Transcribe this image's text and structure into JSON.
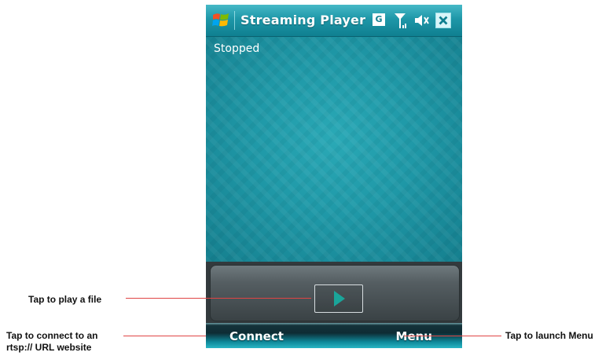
{
  "window": {
    "title": "Streaming Player",
    "status_icons": [
      "windows-start-icon",
      "gprs-icon",
      "signal-icon",
      "volume-muted-icon",
      "close-icon"
    ],
    "gprs_label": "G"
  },
  "player": {
    "state": "Stopped",
    "play_icon": "play-icon"
  },
  "softkeys": {
    "left": "Connect",
    "right": "Menu"
  },
  "callouts": {
    "play": "Tap to play a file",
    "connect_line1": "Tap to connect to an",
    "connect_line2": "rtsp:// URL website",
    "menu": "Tap to launch Menu"
  },
  "colors": {
    "accent": "#1e97a8",
    "callout_line": "#e04545"
  }
}
